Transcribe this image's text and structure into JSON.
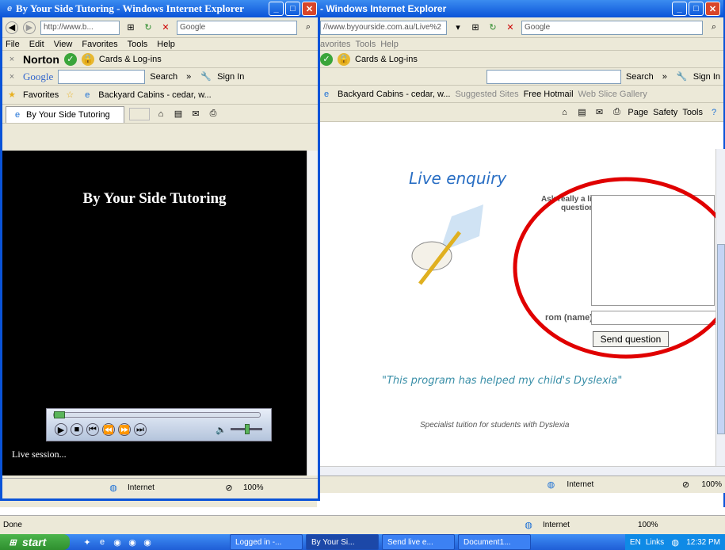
{
  "back_window": {
    "title": "- Windows Internet Explorer",
    "url": "//www.byyourside.com.au/Live%2",
    "search_engine": "Google",
    "menu": [
      "avorites",
      "Tools",
      "Help"
    ],
    "cards_label": "Cards & Log-ins",
    "google_toolbar": {
      "search": "Search",
      "sign_in": "Sign In"
    },
    "favorites_bar": [
      "Backyard Cabins - cedar, w...",
      "Suggested Sites",
      "Free Hotmail",
      "Web Slice Gallery"
    ],
    "commands": [
      "Page",
      "Safety",
      "Tools"
    ],
    "page": {
      "heading": "Live enquiry",
      "ask_label": "Ask really a live question...",
      "from_label": "rom (name):",
      "send_button": "Send question",
      "quote": "\"This program has helped my child's Dyslexia\"",
      "tagline": "Specialist tuition for students with Dyslexia"
    },
    "status_zone": "Internet",
    "zoom": "100%"
  },
  "front_window": {
    "title": "By Your Side Tutoring - Windows Internet Explorer",
    "url": "http://www.b...",
    "search_engine": "Google",
    "menu": [
      "File",
      "Edit",
      "View",
      "Favorites",
      "Tools",
      "Help"
    ],
    "norton": "Norton",
    "cards_label": "Cards & Log-ins",
    "google_label": "Google",
    "google_toolbar": {
      "search": "Search",
      "sign_in": "Sign In"
    },
    "favorites_label": "Favorites",
    "favorites_bar": [
      "Backyard Cabins - cedar, w..."
    ],
    "tab": "By Your Side Tutoring",
    "page": {
      "heading": "By Your Side Tutoring",
      "session": "Live session..."
    },
    "status_zone": "Internet",
    "zoom": "100%"
  },
  "outer_status": {
    "text": "Done",
    "zone": "Internet",
    "zoom": "100%"
  },
  "taskbar": {
    "start": "start",
    "tasks": [
      "Logged in -...",
      "By Your Si...",
      "Send live e...",
      "Document1..."
    ],
    "lang": "EN",
    "links": "Links",
    "clock": "12:32 PM"
  },
  "colors": {
    "xp_blue": "#0a53d8",
    "annotation_red": "#e00000",
    "heading_blue": "#2a6fc4",
    "quote_teal": "#3a8fa8"
  }
}
